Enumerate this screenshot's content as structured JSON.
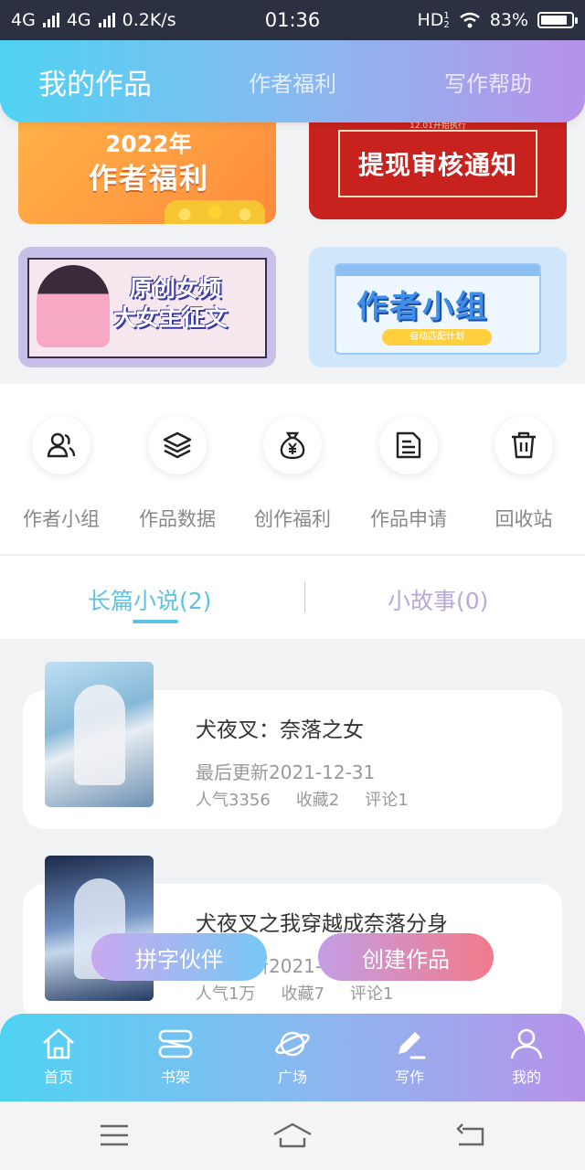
{
  "status_bar": {
    "network_1": "4G",
    "network_2": "4G",
    "speed": "0.2K/s",
    "time": "01:36",
    "hd_label": "HD",
    "hd_sup": "1",
    "hd_sub": "2",
    "battery": "83%",
    "battery_level": 0.83
  },
  "header": {
    "tabs": [
      {
        "label": "我的作品",
        "active": true
      },
      {
        "label": "作者福利",
        "active": false
      },
      {
        "label": "写作帮助",
        "active": false
      }
    ]
  },
  "banners": [
    {
      "line1": "2022年",
      "line2": "作者福利"
    },
    {
      "small": "12.01开始执行",
      "title": "提现审核通知"
    },
    {
      "line1": "原创女频",
      "line2": "大女主征文"
    },
    {
      "title": "作者小组",
      "pill": "自动匹配计划"
    }
  ],
  "shortcuts": [
    {
      "icon": "group-icon",
      "label": "作者小组"
    },
    {
      "icon": "layers-icon",
      "label": "作品数据"
    },
    {
      "icon": "money-bag-icon",
      "label": "创作福利"
    },
    {
      "icon": "document-icon",
      "label": "作品申请"
    },
    {
      "icon": "trash-icon",
      "label": "回收站"
    }
  ],
  "work_tabs": [
    {
      "label": "长篇小说(2)",
      "active": true
    },
    {
      "label": "小故事(0)",
      "active": false
    }
  ],
  "works": [
    {
      "title": "犬夜叉：奈落之女",
      "updated": "最后更新2021-12-31",
      "popularity": "人气3356",
      "favorites": "收藏2",
      "comments": "评论1"
    },
    {
      "title": "犬夜叉之我穿越成奈落分身",
      "updated": "最后更新2021-",
      "popularity": "人气1万",
      "favorites": "收藏7",
      "comments": "评论1"
    }
  ],
  "floating_buttons": {
    "partner": "拼字伙伴",
    "create": "创建作品"
  },
  "bottom_nav": [
    {
      "icon": "home-icon",
      "label": "首页"
    },
    {
      "icon": "bookshelf-icon",
      "label": "书架"
    },
    {
      "icon": "planet-icon",
      "label": "广场"
    },
    {
      "icon": "pen-icon",
      "label": "写作"
    },
    {
      "icon": "user-icon",
      "label": "我的"
    }
  ],
  "colors": {
    "accent_cyan": "#4fd3f3",
    "accent_purple": "#b692ea",
    "active_tab": "#5ec3e3",
    "create_button": "#f27a8b"
  }
}
